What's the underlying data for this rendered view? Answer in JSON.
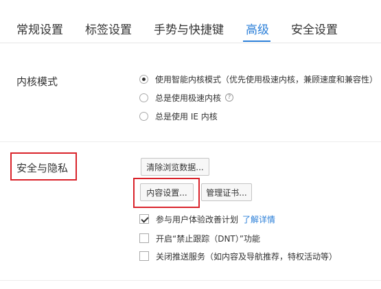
{
  "tabs": [
    {
      "label": "常规设置"
    },
    {
      "label": "标签设置"
    },
    {
      "label": "手势与快捷键"
    },
    {
      "label": "高级"
    },
    {
      "label": "安全设置"
    }
  ],
  "kernel": {
    "label": "内核模式",
    "options": [
      {
        "label": "使用智能内核模式（优先使用极速内核，兼顾速度和兼容性）",
        "selected": true
      },
      {
        "label": "总是使用极速内核",
        "selected": false
      },
      {
        "label": "总是使用 IE 内核",
        "selected": false
      }
    ],
    "help_icon": "?"
  },
  "privacy": {
    "label": "安全与隐私",
    "clear_button": "清除浏览数据...",
    "content_button": "内容设置...",
    "cert_button": "管理证书...",
    "checkboxes": [
      {
        "label": "参与用户体验改善计划",
        "checked": true,
        "link": "了解详情"
      },
      {
        "label": "开启“禁止跟踪（DNT）”功能",
        "checked": false
      },
      {
        "label": "关闭推送服务（如内容及导航推荐，特权活动等）",
        "checked": false
      }
    ]
  },
  "colors": {
    "accent": "#2b7fd8",
    "highlight": "#d9222a"
  }
}
